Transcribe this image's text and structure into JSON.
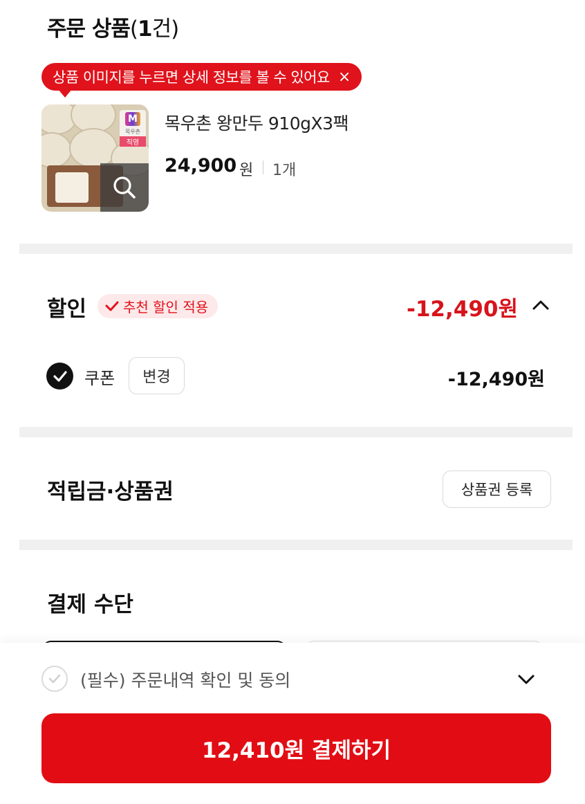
{
  "order": {
    "title": "주문 상품",
    "count_open": "(",
    "count_num": "1",
    "count_close": "건)",
    "tooltip": "상품 이미지를 누르면 상세 정보를 볼 수 있어요",
    "tooltip_close": "×",
    "product": {
      "name": "목우촌 왕만두 910gX3팩",
      "price": "24,900",
      "currency": "원",
      "quantity": "1개",
      "badge_top": "M",
      "badge_brand": "목우촌",
      "badge_direct": "직영"
    }
  },
  "discount": {
    "title": "할인",
    "recommend_badge": "추천 할인 적용",
    "total": "-12,490원",
    "coupon_label": "쿠폰",
    "change_button": "변경",
    "coupon_amount": "-12,490원"
  },
  "points": {
    "title": "적립금·상품권",
    "voucher_button": "상품권 등록"
  },
  "payment": {
    "title": "결제 수단"
  },
  "footer": {
    "agreement": "(필수) 주문내역 확인 및 동의",
    "pay_button": "12,410원 결제하기"
  },
  "colors": {
    "accent": "#e20d14",
    "discount_red": "#d7141c",
    "badge_bg": "#fde9ea"
  }
}
